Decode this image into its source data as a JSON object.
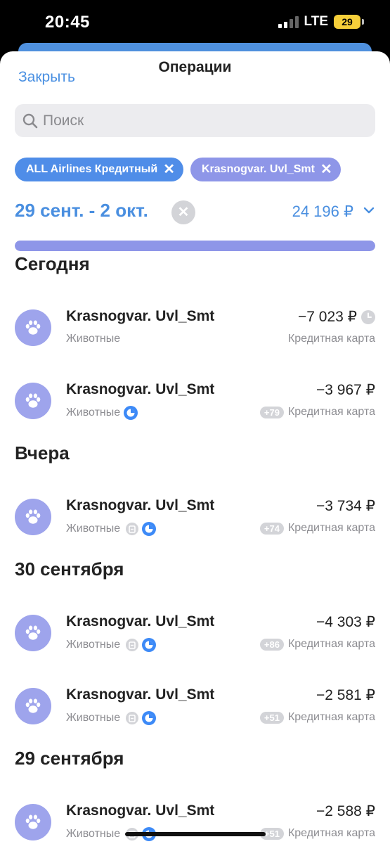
{
  "status": {
    "time": "20:45",
    "network": "LTE",
    "battery": "29"
  },
  "header": {
    "close_label": "Закрыть",
    "title": "Операции"
  },
  "search": {
    "placeholder": "Поиск",
    "value": ""
  },
  "filters": [
    {
      "label": "ALL Airlines Кредитный",
      "color": "#4f8de8"
    },
    {
      "label": "Krasnogvar. Uvl_Smt",
      "color": "#8e96e8"
    }
  ],
  "period": {
    "label": "29 сент. - 2 окт.",
    "total": "24 196 ₽",
    "progress_percent": 100
  },
  "sections": [
    {
      "title": "Сегодня",
      "transactions": [
        {
          "name": "Krasnogvar. Uvl_Smt",
          "category": "Животные",
          "amount": "−7 023 ₽",
          "account": "Кредитная карта",
          "pending": true,
          "icons": [],
          "badge": ""
        },
        {
          "name": "Krasnogvar. Uvl_Smt",
          "category": "Животные",
          "amount": "−3 967 ₽",
          "account": "Кредитная карта",
          "pending": false,
          "icons": [
            "pie"
          ],
          "badge": "+79"
        }
      ]
    },
    {
      "title": "Вчера",
      "transactions": [
        {
          "name": "Krasnogvar. Uvl_Smt",
          "category": "Животные",
          "amount": "−3 734 ₽",
          "account": "Кредитная карта",
          "pending": false,
          "icons": [
            "b",
            "pie"
          ],
          "badge": "+74"
        }
      ]
    },
    {
      "title": "30 сентября",
      "transactions": [
        {
          "name": "Krasnogvar. Uvl_Smt",
          "category": "Животные",
          "amount": "−4 303 ₽",
          "account": "Кредитная карта",
          "pending": false,
          "icons": [
            "b",
            "pie"
          ],
          "badge": "+86"
        },
        {
          "name": "Krasnogvar. Uvl_Smt",
          "category": "Животные",
          "amount": "−2 581 ₽",
          "account": "Кредитная карта",
          "pending": false,
          "icons": [
            "b",
            "pie"
          ],
          "badge": "+51"
        }
      ]
    },
    {
      "title": "29 сентября",
      "transactions": [
        {
          "name": "Krasnogvar. Uvl_Smt",
          "category": "Животные",
          "amount": "−2 588 ₽",
          "account": "Кредитная карта",
          "pending": false,
          "icons": [
            "b",
            "pie"
          ],
          "badge": "+51"
        }
      ]
    }
  ]
}
